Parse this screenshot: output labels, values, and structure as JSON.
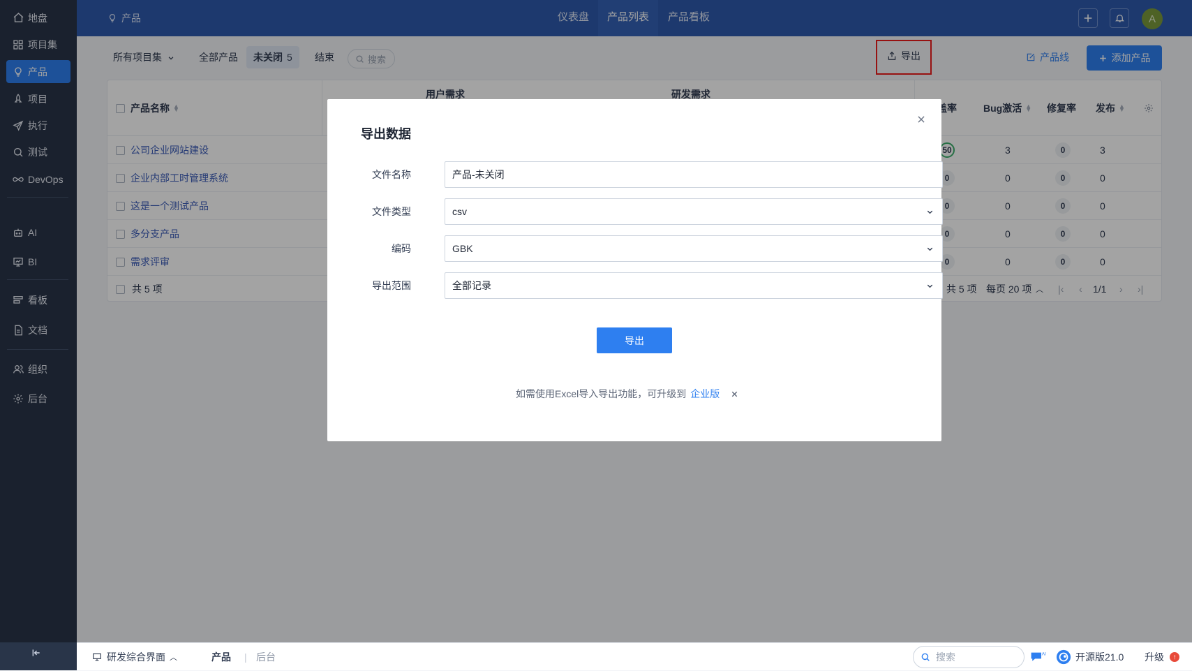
{
  "sidebar": {
    "items": [
      {
        "label": "地盘",
        "icon": "home-icon"
      },
      {
        "label": "项目集",
        "icon": "grid-icon"
      },
      {
        "label": "产品",
        "icon": "lightbulb-icon"
      },
      {
        "label": "项目",
        "icon": "rocket-icon"
      },
      {
        "label": "执行",
        "icon": "send-icon"
      },
      {
        "label": "测试",
        "icon": "magnifier-icon"
      },
      {
        "label": "DevOps",
        "icon": "infinity-icon"
      },
      {
        "label": "AI",
        "icon": "robot-icon"
      },
      {
        "label": "BI",
        "icon": "chart-icon"
      },
      {
        "label": "看板",
        "icon": "kanban-icon"
      },
      {
        "label": "文档",
        "icon": "document-icon"
      },
      {
        "label": "组织",
        "icon": "users-icon"
      },
      {
        "label": "后台",
        "icon": "gear-icon"
      }
    ],
    "active": "产品"
  },
  "header": {
    "breadcrumb": "产品",
    "tabs": [
      "仪表盘",
      "产品列表",
      "产品看板"
    ],
    "active_tab": "产品列表",
    "avatar": "A"
  },
  "toolbar": {
    "program_filter": "所有项目集",
    "tab_all": "全部产品",
    "tab_open": "未关闭",
    "tab_open_count": "5",
    "tab_closed": "结束",
    "search_label": "搜索",
    "export_label": "导出",
    "product_line_label": "产品线",
    "add_product_label": "添加产品"
  },
  "table": {
    "col_name": "产品名称",
    "group_user_req": "用户需求",
    "group_dev_req": "研发需求",
    "col_coverage": "覆盖率",
    "col_bug_active": "Bug激活",
    "col_fix_rate": "修复率",
    "col_release": "发布",
    "rows": [
      {
        "name": "公司企业网站建设",
        "coverage": "50",
        "bug_active": "3",
        "fix_rate": "0",
        "release": "3"
      },
      {
        "name": "企业内部工时管理系统",
        "coverage": "0",
        "bug_active": "0",
        "fix_rate": "0",
        "release": "0"
      },
      {
        "name": "这是一个测试产品",
        "coverage": "0",
        "bug_active": "0",
        "fix_rate": "0",
        "release": "0"
      },
      {
        "name": "多分支产品",
        "coverage": "0",
        "bug_active": "0",
        "fix_rate": "0",
        "release": "0"
      },
      {
        "name": "需求评审",
        "coverage": "0",
        "bug_active": "0",
        "fix_rate": "0",
        "release": "0"
      }
    ],
    "footer_total": "共 5 项",
    "pager_total": "共 5 项",
    "pager_per_page": "每页 20 项",
    "pager_page": "1/1"
  },
  "modal": {
    "title": "导出数据",
    "file_name_label": "文件名称",
    "file_name_value": "产品-未关闭",
    "file_type_label": "文件类型",
    "file_type_value": "csv",
    "encoding_label": "编码",
    "encoding_value": "GBK",
    "range_label": "导出范围",
    "range_value": "全部记录",
    "submit_label": "导出",
    "notice_text": "如需使用Excel导入导出功能，可升级到",
    "notice_link": "企业版"
  },
  "bottombar": {
    "workspace": "研发综合界面",
    "crumb_product": "产品",
    "crumb_admin": "后台",
    "search_placeholder": "搜索",
    "version": "开源版21.0",
    "upgrade": "升级"
  },
  "colors": {
    "sidebar_bg": "#293549",
    "header_bg": "#2e5aac",
    "primary": "#2e7ff0",
    "highlight_box": "#ec1c1c"
  }
}
